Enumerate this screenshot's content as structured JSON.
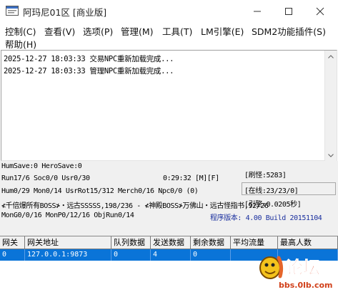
{
  "window": {
    "title": "阿玛尼01区 [商业版]",
    "controls": [
      "minimize-icon",
      "maximize-icon",
      "close-icon"
    ]
  },
  "menu": [
    {
      "label": "控制(C)"
    },
    {
      "label": "查看(V)"
    },
    {
      "label": "选项(P)"
    },
    {
      "label": "管理(M)"
    },
    {
      "label": "工具(T)"
    },
    {
      "label": "LM引擎(E)"
    },
    {
      "label": "SDM2功能插件(S)"
    },
    {
      "label": "帮助(H)"
    }
  ],
  "log": [
    "2025-12-27 18:03:33 交易NPC重新加载完成...",
    "2025-12-27 18:03:33 管理NPC重新加载完成..."
  ],
  "status": {
    "line1": "HumSave:0 HeroSave:0",
    "line2": "Run17/6 Soc0/0 Usr0/30",
    "time": "0:29:32 [M][F]",
    "line3": "Hum0/29 Mon0/14 UsrRot15/312 Merch0/16 Npc0/0 (0)",
    "line4": "≮千倍爆所有BOSS≯・远古SSSSS,198/236 - ≮神殿BOSS≯万佛山・远古怪指书,92/26",
    "line5": "MonG0/0/16 MonP0/12/16 ObjRun0/14",
    "monsters": "[刷怪:5283]",
    "online": "[在线:23/23/0]",
    "engine": "[引擎:0.0205秒]",
    "version": "程序版本: 4.00 Build 20151104"
  },
  "table": {
    "headers": [
      "网关",
      "网关地址",
      "队列数据",
      "发送数据",
      "剩余数据",
      "平均流量",
      "最高人数"
    ],
    "rows": [
      [
        "0",
        "127.0.0.1:9873",
        "0",
        "4",
        "0",
        "",
        ""
      ]
    ]
  },
  "watermark": {
    "text": "论坛",
    "url": "bbs.0lb.com"
  },
  "colors": {
    "selected_row": "#0a74d8",
    "version_text": "#1a2f9e",
    "panel": "#f0f0f0"
  }
}
